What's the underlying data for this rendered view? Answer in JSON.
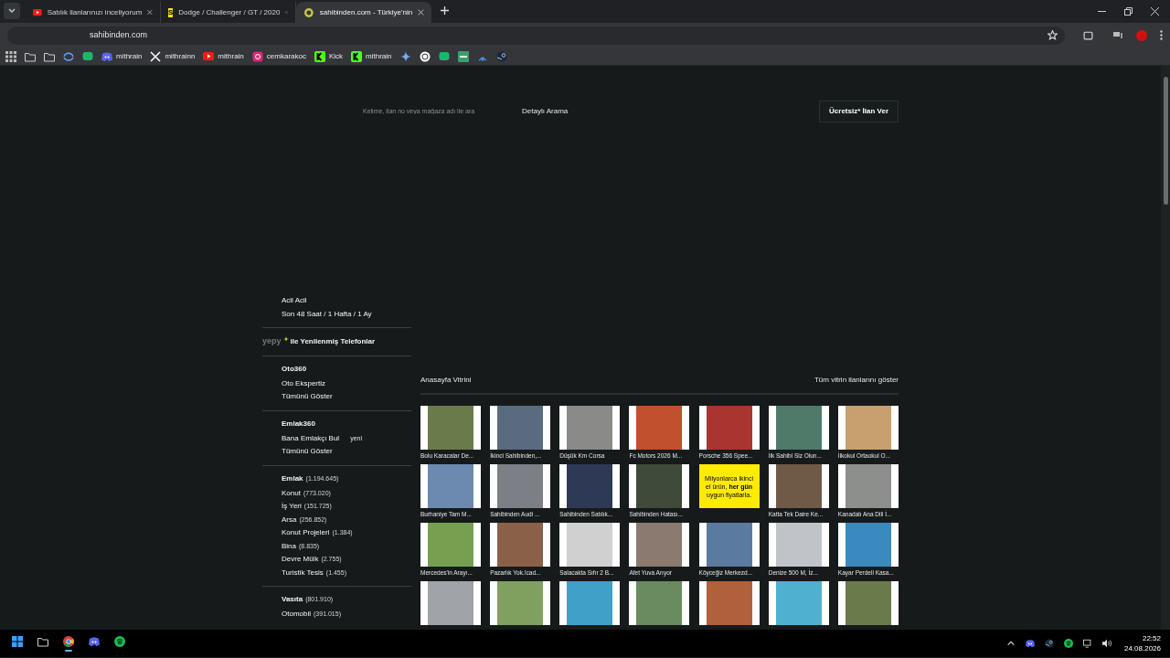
{
  "browser": {
    "tabs": [
      {
        "title": "Satılık ilanlarınızı inceliyorum",
        "selected": false
      },
      {
        "title": "Dodge / Challenger / GT / 2020",
        "icon_text": "S",
        "selected": false
      },
      {
        "title": "sahibinden.com - Türkiye'nin",
        "selected": true
      }
    ],
    "address": "sahibinden.com",
    "bookmarks": [
      {
        "label": "mithrain"
      },
      {
        "label": "mithrainn"
      },
      {
        "label": "mithrain"
      },
      {
        "label": "cemkarakoc"
      },
      {
        "label": "Kick"
      },
      {
        "label": "mithrain"
      }
    ]
  },
  "page": {
    "search": {
      "placeholder": "Kelime, ilan no veya mağaza adı ile ara"
    },
    "detailed_search": "Detaylı Arama",
    "post_button": "Ücretsiz* İlan Ver",
    "sidebar": [
      {
        "kind": "list",
        "items": [
          {
            "label": "Acil Acil"
          },
          {
            "label": "Son 48 Saat / 1 Hafta / 1 Ay"
          }
        ]
      },
      {
        "kind": "promo",
        "brand": "yepy",
        "label": "ile Yenilenmiş Telefonlar"
      },
      {
        "kind": "list",
        "title": "Oto360",
        "items": [
          {
            "label": "Oto Ekspertiz"
          },
          {
            "label": "Tümünü Göster"
          }
        ]
      },
      {
        "kind": "list",
        "title": "Emlak360",
        "items": [
          {
            "label": "Bana Emlakçı Bul",
            "badge": "yeni"
          },
          {
            "label": "Tümünü Göster"
          }
        ]
      },
      {
        "kind": "list",
        "title": "Emlak",
        "count": "(1.194.645)",
        "items": [
          {
            "label": "Konut",
            "count": "(773.020)"
          },
          {
            "label": "İş Yeri",
            "count": "(151.725)"
          },
          {
            "label": "Arsa",
            "count": "(256.852)"
          },
          {
            "label": "Konut Projeleri",
            "count": "(1.384)"
          },
          {
            "label": "Bina",
            "count": "(8.835)"
          },
          {
            "label": "Devre Mülk",
            "count": "(2.755)"
          },
          {
            "label": "Turistik Tesis",
            "count": "(1.455)"
          }
        ]
      },
      {
        "kind": "list",
        "title": "Vasıta",
        "count": "(801.910)",
        "items": [
          {
            "label": "Otomobil",
            "count": "(391.015)"
          }
        ]
      }
    ],
    "showcase": {
      "title": "Anasayfa Vitrini",
      "link": "Tüm vitrin ilanlarını göster",
      "tiles": [
        {
          "kind": "listing",
          "caption": "Bolu Karacalar De..."
        },
        {
          "kind": "listing",
          "caption": "İkinci Sahibinden,..."
        },
        {
          "kind": "listing",
          "caption": "Düşük Km Corsa"
        },
        {
          "kind": "listing",
          "caption": "Fc Motors 2026 M..."
        },
        {
          "kind": "listing",
          "caption": "Porsche 356 Spee..."
        },
        {
          "kind": "listing",
          "caption": "İlk Sahibi Siz Olun..."
        },
        {
          "kind": "listing",
          "caption": "İlkokul Ortaokul O..."
        },
        {
          "kind": "listing",
          "caption": "Burhaniye Tam M..."
        },
        {
          "kind": "listing",
          "caption": "Sahibinden Audi ..."
        },
        {
          "kind": "listing",
          "caption": "Sahibinden Satılık..."
        },
        {
          "kind": "listing",
          "caption": "Sahibinden Hatası..."
        },
        {
          "kind": "ad",
          "text": "Milyonlarca ikinci el ürün, **her gün** uygun fiyatlarla."
        },
        {
          "kind": "listing",
          "caption": "Katta Tek Daire Ke..."
        },
        {
          "kind": "listing",
          "caption": "Kanadalı Ana Dili İ..."
        },
        {
          "kind": "listing",
          "caption": "Mercedes'in Arayı..."
        },
        {
          "kind": "listing",
          "caption": "Pazarlık Yok.!cad..."
        },
        {
          "kind": "listing",
          "caption": "Salacakta Sıfır 2 B..."
        },
        {
          "kind": "listing",
          "caption": "Afet Yuva Arıyor"
        },
        {
          "kind": "listing",
          "caption": "Köyceğiz Merkezd..."
        },
        {
          "kind": "listing",
          "caption": "Denize 500 M, İz..."
        },
        {
          "kind": "listing",
          "caption": "Kayar Perdeli Kasa..."
        },
        {
          "kind": "listing"
        },
        {
          "kind": "listing"
        },
        {
          "kind": "listing"
        },
        {
          "kind": "listing"
        },
        {
          "kind": "listing"
        },
        {
          "kind": "listing"
        },
        {
          "kind": "listing"
        }
      ]
    }
  },
  "taskbar": {
    "apps": [
      {
        "selected": false
      },
      {
        "selected": false
      },
      {
        "selected": true
      },
      {
        "selected": false
      },
      {
        "selected": false
      }
    ],
    "time": "22:52",
    "date": "24.08.2026"
  }
}
